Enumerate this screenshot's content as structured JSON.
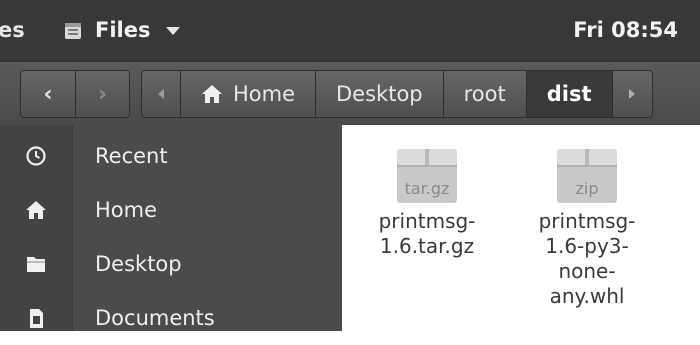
{
  "topbar": {
    "left_partial": "es",
    "app_name": "Files",
    "clock": "Fri 08:54"
  },
  "nav": {
    "back_glyph": "‹",
    "forward_glyph": "›"
  },
  "pathbar": {
    "crumbs": [
      {
        "label": "Home",
        "icon": "home-icon"
      },
      {
        "label": "Desktop"
      },
      {
        "label": "root"
      },
      {
        "label": "dist",
        "current": true
      }
    ]
  },
  "sidebar": {
    "items": [
      {
        "label": "Recent",
        "icon": "clock-icon"
      },
      {
        "label": "Home",
        "icon": "home-icon"
      },
      {
        "label": "Desktop",
        "icon": "folder-icon"
      },
      {
        "label": "Documents",
        "icon": "document-icon"
      }
    ]
  },
  "files": [
    {
      "badge": "tar.gz",
      "name": "printmsg-1.6.tar.gz",
      "icon": "package-icon"
    },
    {
      "badge": "zip",
      "name": "printmsg-1.6-py3-none-any.whl",
      "icon": "package-icon"
    }
  ]
}
